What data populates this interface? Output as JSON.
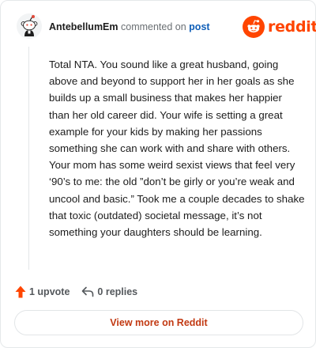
{
  "header": {
    "username": "AntebellumEm",
    "action_text": "commented on",
    "post_link": "post"
  },
  "logo": {
    "icon": "reddit-alien-icon",
    "wordmark": "reddit",
    "color": "#ff4500"
  },
  "comment": {
    "body": "Total NTA. You sound like a great husband, going above and beyond to support her in her goals as she builds up a small business that makes her happier than her old career did. Your wife is setting a great example for your kids by making her passions something she can work with and share with others. Your mom has some weird sexist views that feel very ‘90’s to me: the old ”don’t be girly or you’re weak and uncool and basic.” Took me a couple decades to shake that toxic (outdated) societal message, it’s not something your daughters should be learning."
  },
  "actions": {
    "upvote_label": "1 upvote",
    "upvote_icon": "upvote-arrow-icon",
    "upvote_color": "#ff4500",
    "replies_label": "0 replies",
    "replies_icon": "reply-arrow-icon"
  },
  "footer": {
    "view_more_label": "View more on Reddit"
  }
}
